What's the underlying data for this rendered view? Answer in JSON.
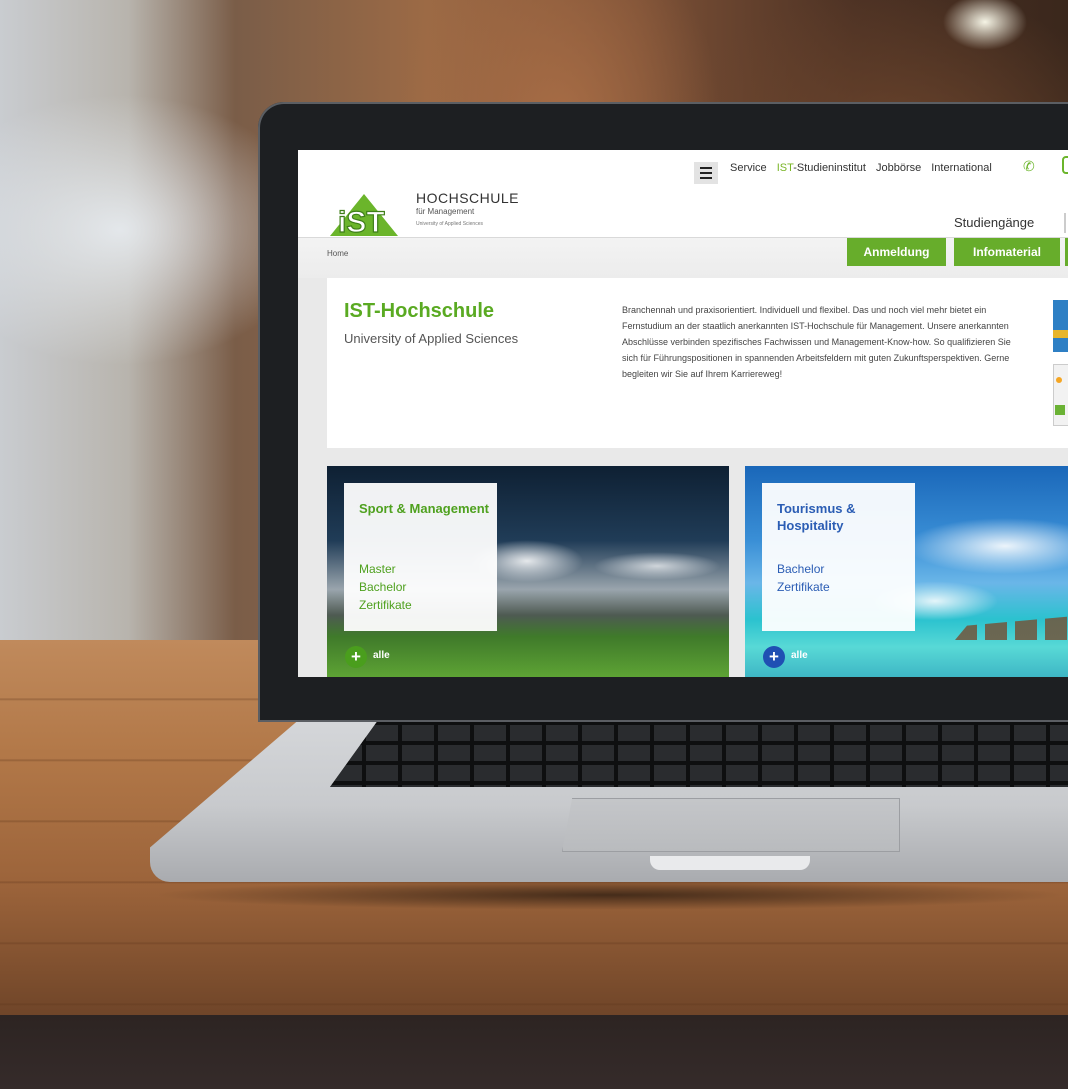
{
  "header": {
    "logo": {
      "mark": "IST",
      "title": "HOCHSCHULE",
      "subtitle": "für Management",
      "tagline": "University of Applied Sciences"
    },
    "menu_icon": "hamburger-icon",
    "nav": [
      {
        "label": "Service"
      },
      {
        "label_prefix": "IST",
        "label_suffix": "-Studieninstitut"
      },
      {
        "label": "Jobbörse"
      },
      {
        "label": "International"
      }
    ],
    "phone_icon": "phone-icon",
    "main_nav": {
      "studiengaenge": "Studiengänge"
    }
  },
  "breadcrumb": {
    "home": "Home"
  },
  "actions": {
    "anmeldung": "Anmeldung",
    "infomaterial": "Infomaterial"
  },
  "intro": {
    "title": "IST-Hochschule",
    "subtitle": "University of Applied Sciences",
    "text": "Branchennah und praxisorientiert. Individuell und flexibel. Das und noch viel mehr bietet ein Fernstudium an der staatlich anerkannten IST-Hochschule für Management. Unsere anerkannten Abschlüsse verbinden spezifisches Fachwissen und Management-Know-how. So qualifizieren Sie sich für Führungspositionen in spannenden Arbeitsfeldern mit guten Zukunftsperspektiven. Gerne begleiten wir Sie auf Ihrem Karriereweg!"
  },
  "cards": [
    {
      "title": "Sport & Management",
      "links": [
        "Master",
        "Bachelor",
        "Zertifikate"
      ],
      "more": "alle",
      "color": "#4fa11f"
    },
    {
      "title": "Tourismus & Hospitality",
      "links": [
        "Bachelor",
        "Zertifikate"
      ],
      "more": "alle",
      "color": "#2b5db4"
    }
  ],
  "colors": {
    "brand_green": "#67ad2b",
    "brand_blue": "#1f4fb3"
  }
}
